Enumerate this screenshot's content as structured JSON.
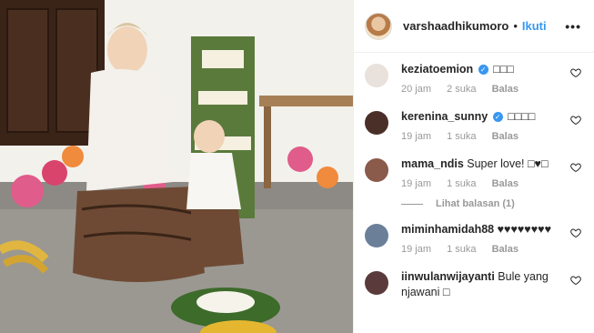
{
  "header": {
    "username": "varshaadhikumoro",
    "separator": "•",
    "follow_label": "Ikuti",
    "more_label": "•••"
  },
  "comments": [
    {
      "user": "keziatoemion",
      "verified": true,
      "text": "□□□",
      "time": "20 jam",
      "likes": "2 suka",
      "reply": "Balas",
      "avatar_color": "#e8e1dc"
    },
    {
      "user": "kerenina_sunny",
      "verified": true,
      "text": "□□□□",
      "time": "19 jam",
      "likes": "1 suka",
      "reply": "Balas",
      "avatar_color": "#4a2f28"
    },
    {
      "user": "mama_ndis",
      "verified": false,
      "text": "Super love! □♥□",
      "time": "19 jam",
      "likes": "1 suka",
      "reply": "Balas",
      "avatar_color": "#8a5a4a"
    },
    {
      "user": "miminhamidah88",
      "verified": false,
      "text": "♥♥♥♥♥♥♥♥",
      "time": "19 jam",
      "likes": "1 suka",
      "reply": "Balas",
      "avatar_color": "#6b7f99"
    },
    {
      "user": "iinwulanwijayanti",
      "verified": false,
      "text": "Bule yang njawani □",
      "time": "",
      "likes": "",
      "reply": "",
      "avatar_color": "#5a3a3a"
    }
  ],
  "view_replies_label": "Lihat balasan (1)",
  "icons": {
    "like": "heart-icon",
    "verified": "verified-badge-icon",
    "more": "more-options-icon"
  },
  "colors": {
    "link": "#3897f0",
    "text": "#262626",
    "muted": "#999999",
    "border": "#efefef"
  }
}
